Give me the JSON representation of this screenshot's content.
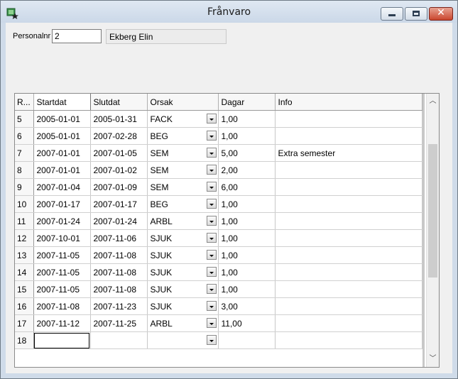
{
  "window": {
    "title": "Frånvaro"
  },
  "form": {
    "personalnr_label": "Personalnr",
    "personalnr_value": "2",
    "name_value": "Ekberg Elin"
  },
  "grid": {
    "columns": [
      "R...",
      "Startdat",
      "Slutdat",
      "Orsak",
      "Dagar",
      "Info"
    ],
    "rows": [
      [
        "5",
        "2005-01-01",
        "2005-01-31",
        "FACK",
        "1,00",
        ""
      ],
      [
        "6",
        "2005-01-01",
        "2007-02-28",
        "BEG",
        "1,00",
        ""
      ],
      [
        "7",
        "2007-01-01",
        "2007-01-05",
        "SEM",
        "5,00",
        "Extra semester"
      ],
      [
        "8",
        "2007-01-01",
        "2007-01-02",
        "SEM",
        "2,00",
        ""
      ],
      [
        "9",
        "2007-01-04",
        "2007-01-09",
        "SEM",
        "6,00",
        ""
      ],
      [
        "10",
        "2007-01-17",
        "2007-01-17",
        "BEG",
        "1,00",
        ""
      ],
      [
        "11",
        "2007-01-24",
        "2007-01-24",
        "ARBL",
        "1,00",
        ""
      ],
      [
        "12",
        "2007-10-01",
        "2007-11-06",
        "SJUK",
        "1,00",
        ""
      ],
      [
        "13",
        "2007-11-05",
        "2007-11-08",
        "SJUK",
        "1,00",
        ""
      ],
      [
        "14",
        "2007-11-05",
        "2007-11-08",
        "SJUK",
        "1,00",
        ""
      ],
      [
        "15",
        "2007-11-05",
        "2007-11-08",
        "SJUK",
        "1,00",
        ""
      ],
      [
        "16",
        "2007-11-08",
        "2007-11-23",
        "SJUK",
        "3,00",
        ""
      ],
      [
        "17",
        "2007-11-12",
        "2007-11-25",
        "ARBL",
        "11,00",
        ""
      ],
      [
        "18",
        "",
        "",
        "",
        "",
        ""
      ]
    ]
  }
}
